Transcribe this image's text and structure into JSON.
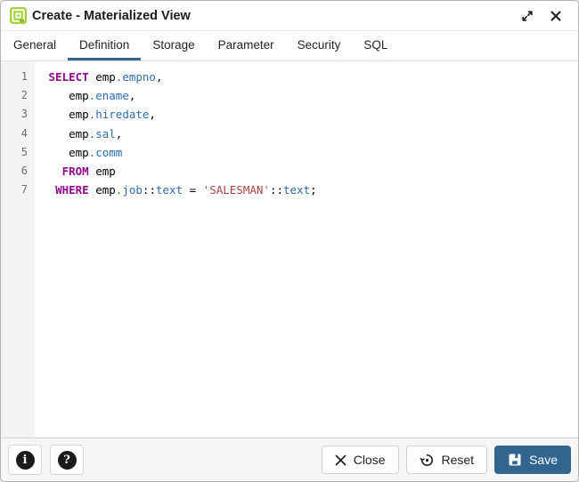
{
  "window": {
    "title": "Create - Materialized View",
    "icon": "materialized-view-icon"
  },
  "tabs": [
    {
      "label": "General",
      "active": false
    },
    {
      "label": "Definition",
      "active": true
    },
    {
      "label": "Storage",
      "active": false
    },
    {
      "label": "Parameter",
      "active": false
    },
    {
      "label": "Security",
      "active": false
    },
    {
      "label": "SQL",
      "active": false
    }
  ],
  "editor": {
    "language": "sql",
    "lines": [
      {
        "num": "1",
        "tokens": [
          [
            "p",
            " "
          ],
          [
            "k",
            "SELECT"
          ],
          [
            "p",
            " emp"
          ],
          [
            "v",
            ".empno"
          ],
          [
            "p",
            ","
          ]
        ]
      },
      {
        "num": "2",
        "tokens": [
          [
            "p",
            "    emp"
          ],
          [
            "v",
            ".ename"
          ],
          [
            "p",
            ","
          ]
        ]
      },
      {
        "num": "3",
        "tokens": [
          [
            "p",
            "    emp"
          ],
          [
            "v",
            ".hiredate"
          ],
          [
            "p",
            ","
          ]
        ]
      },
      {
        "num": "4",
        "tokens": [
          [
            "p",
            "    emp"
          ],
          [
            "v",
            ".sal"
          ],
          [
            "p",
            ","
          ]
        ]
      },
      {
        "num": "5",
        "tokens": [
          [
            "p",
            "    emp"
          ],
          [
            "v",
            ".comm"
          ]
        ]
      },
      {
        "num": "6",
        "tokens": [
          [
            "p",
            "   "
          ],
          [
            "k",
            "FROM"
          ],
          [
            "p",
            " emp"
          ]
        ]
      },
      {
        "num": "7",
        "tokens": [
          [
            "p",
            "  "
          ],
          [
            "k",
            "WHERE"
          ],
          [
            "p",
            " emp"
          ],
          [
            "v",
            ".job"
          ],
          [
            "p",
            "::"
          ],
          [
            "v",
            "text"
          ],
          [
            "p",
            " = "
          ],
          [
            "s",
            "'SALESMAN'"
          ],
          [
            "p",
            "::"
          ],
          [
            "v",
            "text"
          ],
          [
            "p",
            ";"
          ]
        ]
      }
    ]
  },
  "footer": {
    "info_glyph": "i",
    "help_glyph": "?",
    "close_label": "Close",
    "reset_label": "Reset",
    "save_label": "Save"
  },
  "colors": {
    "accent": "#326690",
    "kw": "#90098c",
    "ident": "#2e6cad",
    "str": "#a94444",
    "green": "#a3cf2d",
    "green_dark": "#7ba31f"
  }
}
